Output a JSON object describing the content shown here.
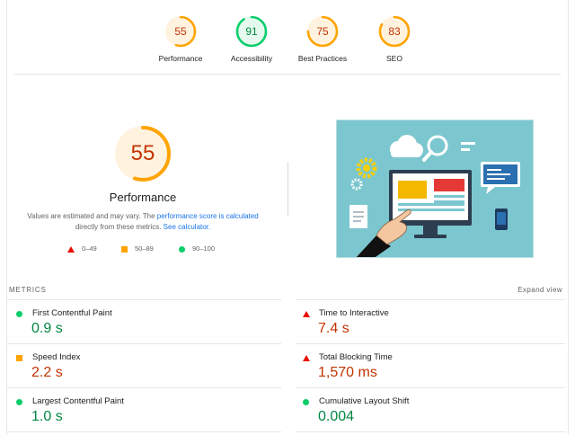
{
  "gauges": [
    {
      "label": "Performance",
      "score": "55",
      "fraction": 0.55,
      "color": "#ffa400",
      "text_color": "#c33300",
      "bg": "#fff3e0"
    },
    {
      "label": "Accessibility",
      "score": "91",
      "fraction": 0.91,
      "color": "#0cce6b",
      "text_color": "#018642",
      "bg": "#e6f9ee"
    },
    {
      "label": "Best Practices",
      "score": "75",
      "fraction": 0.75,
      "color": "#ffa400",
      "text_color": "#c33300",
      "bg": "#fff3e0"
    },
    {
      "label": "SEO",
      "score": "83",
      "fraction": 0.83,
      "color": "#ffa400",
      "text_color": "#c33300",
      "bg": "#fff3e0"
    }
  ],
  "performance": {
    "score": "55",
    "fraction": 0.55,
    "title": "Performance",
    "desc_prefix": "Values are estimated and may vary. The ",
    "desc_link1": "performance score is calculated",
    "desc_mid": " directly from these metrics. ",
    "desc_link2": "See calculator."
  },
  "legend": [
    {
      "icon": "fail-triangle-icon",
      "range": "0–49"
    },
    {
      "icon": "average-square-icon",
      "range": "50–89"
    },
    {
      "icon": "pass-circle-icon",
      "range": "90–100"
    }
  ],
  "metrics": {
    "heading": "METRICS",
    "expand_label": "Expand view",
    "items": [
      {
        "name": "First Contentful Paint",
        "value": "0.9 s",
        "status": "pass"
      },
      {
        "name": "Time to Interactive",
        "value": "7.4 s",
        "status": "fail"
      },
      {
        "name": "Speed Index",
        "value": "2.2 s",
        "status": "average"
      },
      {
        "name": "Total Blocking Time",
        "value": "1,570 ms",
        "status": "fail"
      },
      {
        "name": "Largest Contentful Paint",
        "value": "1.0 s",
        "status": "pass"
      },
      {
        "name": "Cumulative Layout Shift",
        "value": "0.004",
        "status": "pass"
      }
    ]
  },
  "colors": {
    "pass": "#0cce6b",
    "average": "#ffa400",
    "fail": "#eb0f00",
    "link": "#1a73e8"
  }
}
